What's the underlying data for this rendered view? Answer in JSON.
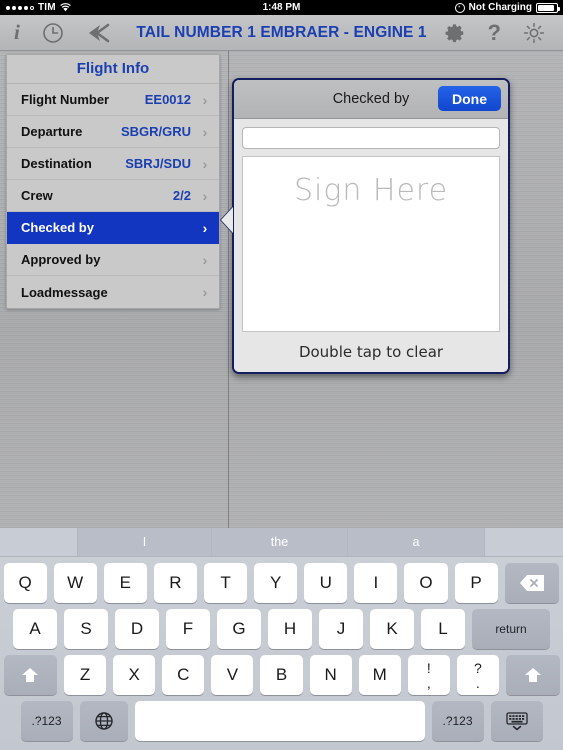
{
  "status_bar": {
    "carrier": "TIM",
    "signal_dots_filled": 4,
    "signal_dots_total": 5,
    "wifi_icon": "wifi-icon",
    "time": "1:48 PM",
    "charging_icon": "bolt-circle-icon",
    "battery_label": "Not Charging",
    "battery_icon": "battery-icon"
  },
  "toolbar": {
    "title": "TAIL NUMBER 1 EMBRAER - ENGINE 1",
    "left_icons": [
      {
        "name": "info-icon",
        "glyph": "i"
      },
      {
        "name": "clock-icon",
        "glyph": "clock"
      },
      {
        "name": "back-arrow-icon",
        "glyph": "back"
      }
    ],
    "right_icons": [
      {
        "name": "gear-icon",
        "glyph": "gear"
      },
      {
        "name": "help-icon",
        "glyph": "?"
      },
      {
        "name": "brightness-icon",
        "glyph": "sun"
      }
    ]
  },
  "flight_info": {
    "header": "Flight Info",
    "rows": [
      {
        "label": "Flight Number",
        "value": "EE0012",
        "selected": false
      },
      {
        "label": "Departure",
        "value": "SBGR/GRU",
        "selected": false
      },
      {
        "label": "Destination",
        "value": "SBRJ/SDU",
        "selected": false
      },
      {
        "label": "Crew",
        "value": "2/2",
        "selected": false
      },
      {
        "label": "Checked by",
        "value": "",
        "selected": true
      },
      {
        "label": "Approved by",
        "value": "",
        "selected": false
      },
      {
        "label": "Loadmessage",
        "value": "",
        "selected": false
      }
    ],
    "chevron": "›"
  },
  "signature_popover": {
    "title": "Checked by",
    "done_label": "Done",
    "name_value": "",
    "name_placeholder": "",
    "sign_placeholder": "Sign Here",
    "clear_hint": "Double tap to clear"
  },
  "keyboard": {
    "predictions": [
      "",
      "I",
      "the",
      "a"
    ],
    "row1": [
      "Q",
      "W",
      "E",
      "R",
      "T",
      "Y",
      "U",
      "I",
      "O",
      "P"
    ],
    "row1_extra": {
      "name": "backspace-key",
      "glyph": "backspace"
    },
    "row2": [
      "A",
      "S",
      "D",
      "F",
      "G",
      "H",
      "J",
      "K",
      "L"
    ],
    "row2_extra": {
      "name": "return-key",
      "label": "return"
    },
    "row3_left": {
      "name": "shift-key-left",
      "glyph": "shift"
    },
    "row3": [
      "Z",
      "X",
      "C",
      "V",
      "B",
      "N",
      "M"
    ],
    "row3_dual": [
      {
        "top": "!",
        "bot": ","
      },
      {
        "top": "?",
        "bot": "."
      }
    ],
    "row3_right": {
      "name": "shift-key-right",
      "glyph": "shift"
    },
    "row4": {
      "numeric_left": ".?123",
      "globe": "globe-key",
      "space": "",
      "numeric_right": ".?123",
      "hide": "hide-keyboard-key"
    }
  },
  "colors": {
    "accent_blue": "#1b3fb0",
    "selection_blue": "#1236c0",
    "done_blue": "#1146cf",
    "popover_border": "#141e5e",
    "panel_gray": "#c9c9c9",
    "metal_gray": "#aeafb1"
  }
}
